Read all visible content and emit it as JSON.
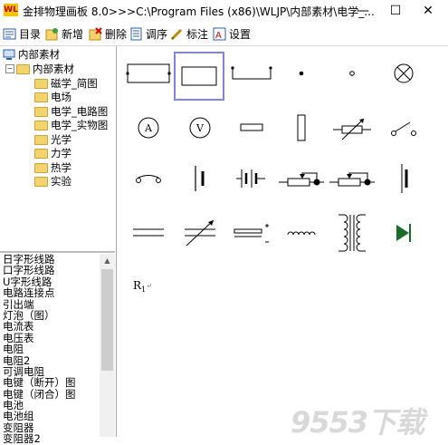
{
  "window": {
    "title": "金排物理画板 8.0>>>C:\\Program Files (x86)\\WLJP\\内部素材\\电学_...",
    "logo_text": "WL",
    "minimize_glyph": "—",
    "maximize_glyph": "☐",
    "close_glyph": "✕"
  },
  "toolbar": {
    "items": [
      {
        "label": "目录",
        "icon": "catalog-icon"
      },
      {
        "label": "新增",
        "icon": "add-icon"
      },
      {
        "label": "删除",
        "icon": "delete-icon"
      },
      {
        "label": "调序",
        "icon": "reorder-icon"
      },
      {
        "label": "标注",
        "icon": "annotate-icon"
      },
      {
        "label": "设置",
        "icon": "settings-icon"
      }
    ]
  },
  "tree": {
    "root": "内部素材",
    "child": "内部素材",
    "folders": [
      "磁学_简图",
      "电场",
      "电学_电路图",
      "电学_实物图",
      "光学",
      "力学",
      "热学",
      "实验"
    ]
  },
  "list": {
    "items": [
      "日字形线路",
      "口字形线路",
      "U字形线路",
      "电路连接点",
      "引出端",
      "灯泡（图）",
      "电流表",
      "电压表",
      "电阻",
      "电阻2",
      "可调电阻",
      "电键（断开）图",
      "电键（闭合）图",
      "电池",
      "电池组",
      "变阻器",
      "变阻器2"
    ]
  },
  "canvas": {
    "labels": {
      "ammeter": "A",
      "voltmeter": "V",
      "r1_main": "R",
      "r1_sub": "1",
      "r1_mark": "↵"
    }
  },
  "watermark": "9553下载"
}
